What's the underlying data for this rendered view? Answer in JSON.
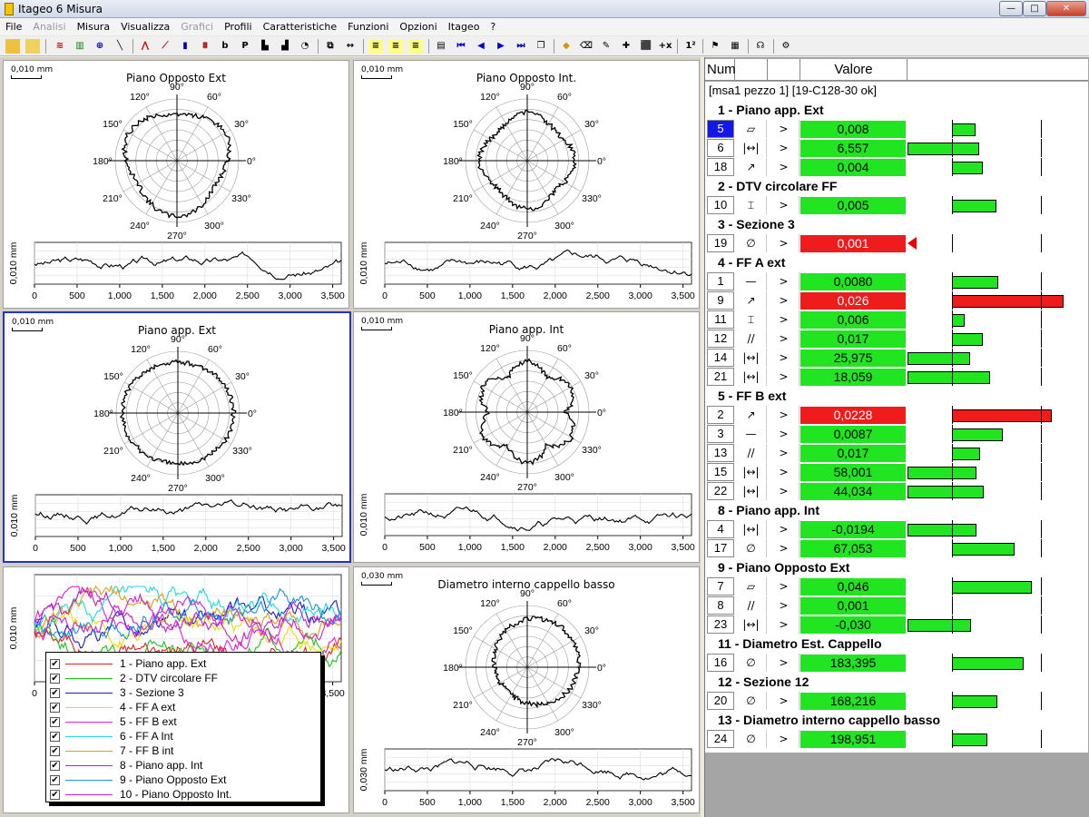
{
  "window": {
    "title": "Itageo 6 Misura",
    "min": "—",
    "max": "□",
    "close": "✕"
  },
  "menu": [
    {
      "label": "File",
      "enabled": true
    },
    {
      "label": "Analisi",
      "enabled": false
    },
    {
      "label": "Misura",
      "enabled": true
    },
    {
      "label": "Visualizza",
      "enabled": true
    },
    {
      "label": "Grafici",
      "enabled": false
    },
    {
      "label": "Profili",
      "enabled": true
    },
    {
      "label": "Caratteristiche",
      "enabled": true
    },
    {
      "label": "Funzioni",
      "enabled": true
    },
    {
      "label": "Opzioni",
      "enabled": true
    },
    {
      "label": "Itageo",
      "enabled": true
    },
    {
      "label": "?",
      "enabled": true
    }
  ],
  "toolbar": {
    "b": "b",
    "p": "P",
    "plus_x": "+x",
    "digits": "1²"
  },
  "panels": {
    "p1": {
      "title": "Piano Opposto Ext",
      "scale": "0,010 mm",
      "ylabel": "0,010 mm"
    },
    "p2": {
      "title": "Piano Opposto Int.",
      "scale": "0,010 mm",
      "ylabel": "0,010 mm"
    },
    "p3": {
      "title": "Piano app. Ext",
      "scale": "0,010 mm",
      "ylabel": "0,010 mm"
    },
    "p4": {
      "title": "Piano app. Int",
      "scale": "0,010 mm",
      "ylabel": "0,010 mm"
    },
    "p5": {
      "ylabel": "0,010 mm"
    },
    "p6": {
      "title": "Diametro interno cappello basso",
      "scale": "0,030 mm",
      "ylabel": "0,030 mm"
    }
  },
  "chart_data": {
    "polar_angle_labels": [
      "90°",
      "60°",
      "30°",
      "0°",
      "330°",
      "300°",
      "270°",
      "240°",
      "210°",
      "180°",
      "150°",
      "120°"
    ],
    "x_ticks": [
      "0",
      "500",
      "1,000",
      "1,500",
      "2,000",
      "2,500",
      "3,000",
      "3,500"
    ],
    "xlim": [
      0,
      3600
    ]
  },
  "legend": [
    {
      "label": "1 - Piano app. Ext",
      "color": "#e02020"
    },
    {
      "label": "2 - DTV circolare FF",
      "color": "#20c020"
    },
    {
      "label": "3 - Sezione 3",
      "color": "#1a1ad0"
    },
    {
      "label": "4 - FF A ext",
      "color": "#e8e000"
    },
    {
      "label": "5 - FF B ext",
      "color": "#e020e0"
    },
    {
      "label": "6 - FF A Int",
      "color": "#20d8e0"
    },
    {
      "label": "7 - FF B int",
      "color": "#d8a020"
    },
    {
      "label": "8 - Piano app. Int",
      "color": "#c020c0"
    },
    {
      "label": "9 - Piano Opposto Ext",
      "color": "#2090e0"
    },
    {
      "label": "10 - Piano Opposto Int.",
      "color": "#d020d0"
    }
  ],
  "legend_check": "✔",
  "table": {
    "header": {
      "num": "Num",
      "valore": "Valore"
    },
    "subheader": "[msa1 pezzo 1] [19-C128-30 ok]",
    "groups": [
      {
        "name": "1 - Piano app. Ext",
        "rows": [
          {
            "num": "5",
            "sym": "▱",
            "op": ">",
            "val": "0,008",
            "status": "ok",
            "bar": 0.27,
            "sel": true
          },
          {
            "num": "6",
            "sym": "|↔|",
            "op": ">",
            "val": "6,557",
            "status": "ok",
            "bar": 0.56
          },
          {
            "num": "18",
            "sym": "↗",
            "op": ">",
            "val": "0,004",
            "status": "ok",
            "bar": 0.35
          }
        ]
      },
      {
        "name": "2 - DTV circolare FF",
        "rows": [
          {
            "num": "10",
            "sym": "⌶",
            "op": ">",
            "val": "0,005",
            "status": "ok",
            "bar": 0.5
          }
        ]
      },
      {
        "name": "3 - Sezione 3",
        "rows": [
          {
            "num": "19",
            "sym": "∅",
            "op": ">",
            "val": "0,001",
            "status": "bad",
            "bar": 0
          }
        ]
      },
      {
        "name": "4 - FF A ext",
        "rows": [
          {
            "num": "1",
            "sym": "—",
            "op": ">",
            "val": "0,0080",
            "status": "ok",
            "bar": 0.52
          },
          {
            "num": "9",
            "sym": "↗",
            "op": ">",
            "val": "0,026",
            "status": "bad",
            "bar": 1.25
          },
          {
            "num": "11",
            "sym": "⌶",
            "op": ">",
            "val": "0,006",
            "status": "ok",
            "bar": 0.14
          },
          {
            "num": "12",
            "sym": "//",
            "op": ">",
            "val": "0,017",
            "status": "ok",
            "bar": 0.35
          },
          {
            "num": "14",
            "sym": "|↔|",
            "op": ">",
            "val": "25,975",
            "status": "ok",
            "bar": 0.37
          },
          {
            "num": "21",
            "sym": "|↔|",
            "op": ">",
            "val": "18,059",
            "status": "ok",
            "bar": 0.78
          }
        ]
      },
      {
        "name": "5 - FF B ext",
        "rows": [
          {
            "num": "2",
            "sym": "↗",
            "op": ">",
            "val": "0,0228",
            "status": "bad",
            "bar": 1.12
          },
          {
            "num": "3",
            "sym": "—",
            "op": ">",
            "val": "0,0087",
            "status": "ok",
            "bar": 0.57
          },
          {
            "num": "13",
            "sym": "//",
            "op": ">",
            "val": "0,017",
            "status": "ok",
            "bar": 0.32
          },
          {
            "num": "15",
            "sym": "|↔|",
            "op": ">",
            "val": "58,001",
            "status": "ok",
            "bar": 0.5
          },
          {
            "num": "22",
            "sym": "|↔|",
            "op": ">",
            "val": "44,034",
            "status": "ok",
            "bar": 0.65
          }
        ]
      },
      {
        "name": "8 - Piano app. Int",
        "rows": [
          {
            "num": "4",
            "sym": "|↔|",
            "op": ">",
            "val": "-0,0194",
            "status": "ok",
            "bar": 0.51
          },
          {
            "num": "17",
            "sym": "∅",
            "op": ">",
            "val": "67,053",
            "status": "ok",
            "bar": 0.7
          }
        ]
      },
      {
        "name": "9 - Piano Opposto Ext",
        "rows": [
          {
            "num": "7",
            "sym": "▱",
            "op": ">",
            "val": "0,046",
            "status": "ok",
            "bar": 0.9
          },
          {
            "num": "8",
            "sym": "//",
            "op": ">",
            "val": "0,001",
            "status": "ok",
            "bar": 0
          },
          {
            "num": "23",
            "sym": "|↔|",
            "op": ">",
            "val": "-0,030",
            "status": "ok",
            "bar": 0.39
          }
        ]
      },
      {
        "name": "11 - Diametro Est. Cappello",
        "rows": [
          {
            "num": "16",
            "sym": "∅",
            "op": ">",
            "val": "183,395",
            "status": "ok",
            "bar": 0.81
          }
        ]
      },
      {
        "name": "12 - Sezione 12",
        "rows": [
          {
            "num": "20",
            "sym": "∅",
            "op": ">",
            "val": "168,216",
            "status": "ok",
            "bar": 0.51
          }
        ]
      },
      {
        "name": "13 - Diametro interno cappello basso",
        "rows": [
          {
            "num": "24",
            "sym": "∅",
            "op": ">",
            "val": "198,951",
            "status": "ok",
            "bar": 0.4
          }
        ]
      }
    ]
  },
  "colors": {
    "ok": "#22e522",
    "bad": "#f01c1c",
    "accent": "#1418e6"
  }
}
